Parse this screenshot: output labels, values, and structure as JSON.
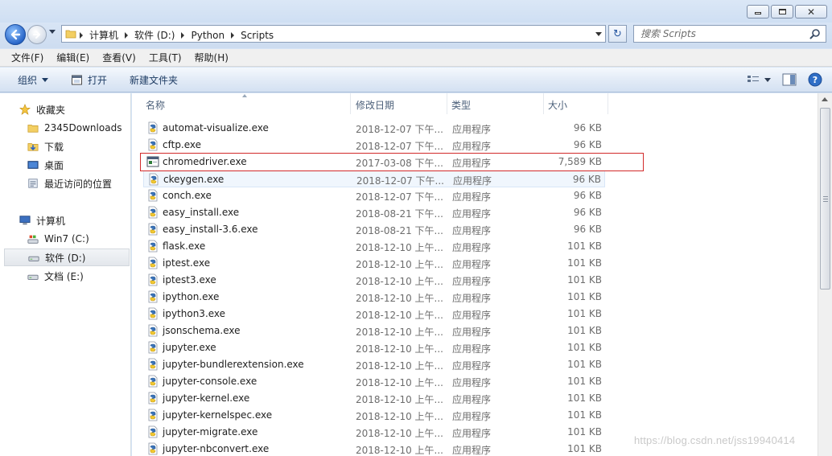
{
  "window": {
    "controls": {
      "minimize": "minimize",
      "maximize": "maximize",
      "close": "close"
    }
  },
  "address": {
    "crumbs": [
      "计算机",
      "软件 (D:)",
      "Python",
      "Scripts"
    ]
  },
  "search": {
    "placeholder": "搜索 Scripts"
  },
  "menu": [
    "文件(F)",
    "编辑(E)",
    "查看(V)",
    "工具(T)",
    "帮助(H)"
  ],
  "toolbar": {
    "organize": "组织",
    "open": "打开",
    "new_folder": "新建文件夹"
  },
  "nav": {
    "favorites": "收藏夹",
    "favorites_items": [
      "2345Downloads",
      "下载",
      "桌面",
      "最近访问的位置"
    ],
    "computer": "计算机",
    "computer_items": [
      "Win7 (C:)",
      "软件 (D:)",
      "文档 (E:)"
    ],
    "selected": "软件 (D:)"
  },
  "columns": {
    "name": "名称",
    "date": "修改日期",
    "type": "类型",
    "size": "大小"
  },
  "files": [
    {
      "name": "automat-visualize.exe",
      "date": "2018-12-07 下午...",
      "type": "应用程序",
      "size": "96 KB",
      "icon": "python-icon"
    },
    {
      "name": "cftp.exe",
      "date": "2018-12-07 下午...",
      "type": "应用程序",
      "size": "96 KB",
      "icon": "python-icon"
    },
    {
      "name": "chromedriver.exe",
      "date": "2017-03-08 下午...",
      "type": "应用程序",
      "size": "7,589 KB",
      "icon": "console-app-icon"
    },
    {
      "name": "ckeygen.exe",
      "date": "2018-12-07 下午...",
      "type": "应用程序",
      "size": "96 KB",
      "icon": "python-icon"
    },
    {
      "name": "conch.exe",
      "date": "2018-12-07 下午...",
      "type": "应用程序",
      "size": "96 KB",
      "icon": "python-icon"
    },
    {
      "name": "easy_install.exe",
      "date": "2018-08-21 下午...",
      "type": "应用程序",
      "size": "96 KB",
      "icon": "python-icon"
    },
    {
      "name": "easy_install-3.6.exe",
      "date": "2018-08-21 下午...",
      "type": "应用程序",
      "size": "96 KB",
      "icon": "python-icon"
    },
    {
      "name": "flask.exe",
      "date": "2018-12-10 上午...",
      "type": "应用程序",
      "size": "101 KB",
      "icon": "python-icon"
    },
    {
      "name": "iptest.exe",
      "date": "2018-12-10 上午...",
      "type": "应用程序",
      "size": "101 KB",
      "icon": "python-icon"
    },
    {
      "name": "iptest3.exe",
      "date": "2018-12-10 上午...",
      "type": "应用程序",
      "size": "101 KB",
      "icon": "python-icon"
    },
    {
      "name": "ipython.exe",
      "date": "2018-12-10 上午...",
      "type": "应用程序",
      "size": "101 KB",
      "icon": "python-icon"
    },
    {
      "name": "ipython3.exe",
      "date": "2018-12-10 上午...",
      "type": "应用程序",
      "size": "101 KB",
      "icon": "python-icon"
    },
    {
      "name": "jsonschema.exe",
      "date": "2018-12-10 上午...",
      "type": "应用程序",
      "size": "101 KB",
      "icon": "python-icon"
    },
    {
      "name": "jupyter.exe",
      "date": "2018-12-10 上午...",
      "type": "应用程序",
      "size": "101 KB",
      "icon": "python-icon"
    },
    {
      "name": "jupyter-bundlerextension.exe",
      "date": "2018-12-10 上午...",
      "type": "应用程序",
      "size": "101 KB",
      "icon": "python-icon"
    },
    {
      "name": "jupyter-console.exe",
      "date": "2018-12-10 上午...",
      "type": "应用程序",
      "size": "101 KB",
      "icon": "python-icon"
    },
    {
      "name": "jupyter-kernel.exe",
      "date": "2018-12-10 上午...",
      "type": "应用程序",
      "size": "101 KB",
      "icon": "python-icon"
    },
    {
      "name": "jupyter-kernelspec.exe",
      "date": "2018-12-10 上午...",
      "type": "应用程序",
      "size": "101 KB",
      "icon": "python-icon"
    },
    {
      "name": "jupyter-migrate.exe",
      "date": "2018-12-10 上午...",
      "type": "应用程序",
      "size": "101 KB",
      "icon": "python-icon"
    },
    {
      "name": "jupyter-nbconvert.exe",
      "date": "2018-12-10 上午...",
      "type": "应用程序",
      "size": "101 KB",
      "icon": "python-icon"
    }
  ],
  "highlight": {
    "file": "chromedriver.exe",
    "color": "#d22a2a"
  },
  "watermark": "https://blog.csdn.net/jss19940414"
}
